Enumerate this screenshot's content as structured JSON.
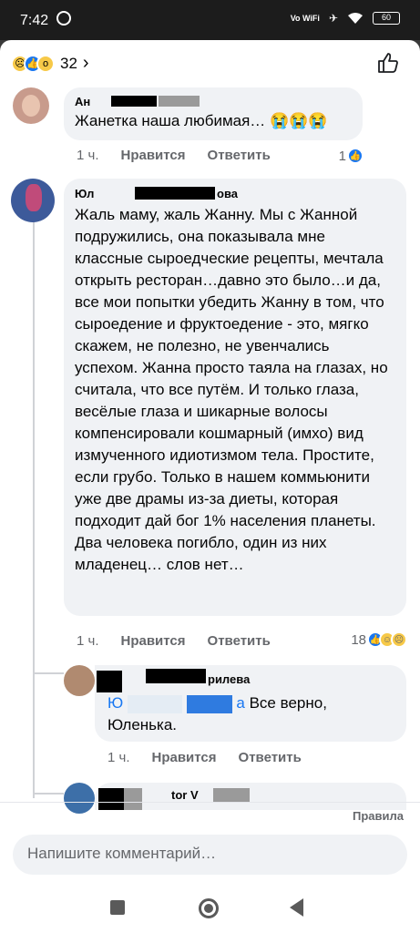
{
  "status_bar": {
    "time": "7:42",
    "network": "Vo WiFi",
    "battery": "60"
  },
  "reactions": {
    "count": "32"
  },
  "comments": [
    {
      "author_visible": "Ан",
      "text": "Жанетка наша любимая… 😭😭😭",
      "time": "1 ч.",
      "like_label": "Нравится",
      "reply_label": "Ответить",
      "reaction_count": "1"
    },
    {
      "author_visible": "Юл",
      "author_suffix": "ова",
      "text": "Жаль маму, жаль Жанну. Мы с Жанной подружились, она показывала мне классные сыроедческие рецепты, мечтала открыть ресторан…давно это было…и да, все мои попытки убедить Жанну в том, что сыроедение и фруктоедение - это, мягко скажем, не полезно, не увенчались успехом. Жанна просто таяла на глазах, но считала, что все путём. И только глаза, весёлые глаза и шикарные волосы компенсировали кошмарный (имхо) вид измученного идиотизмом тела. Простите, если грубо. Только в нашем коммьюнити уже две драмы из-за диеты, которая подходит дай бог 1% населения планеты. Два человека погибло, один из них младенец… слов нет…",
      "time": "1 ч.",
      "like_label": "Нравится",
      "reply_label": "Ответить",
      "reaction_count": "18"
    }
  ],
  "reply": {
    "author_suffix": "рилева",
    "mention_start": "Ю",
    "mention_end": "а",
    "text": "Все верно, Юленька.",
    "time": "1 ч.",
    "like_label": "Нравится",
    "reply_label": "Ответить"
  },
  "next_reply": {
    "author_fragment": "tor V"
  },
  "footer": {
    "rules_label": "Правила",
    "input_placeholder": "Напишите комментарий…"
  }
}
